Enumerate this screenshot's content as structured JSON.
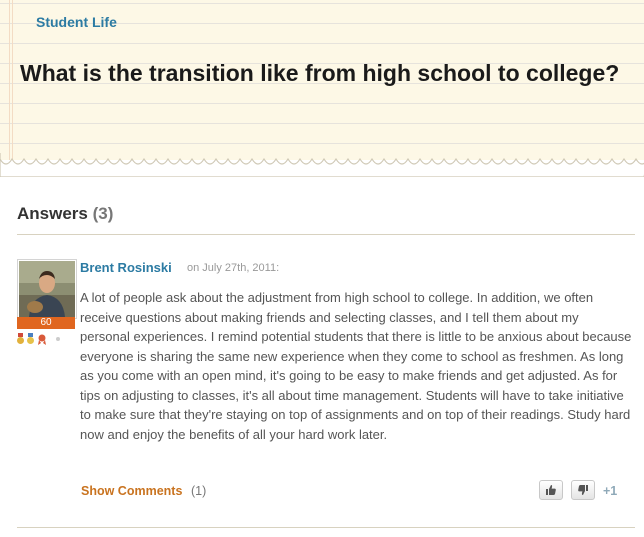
{
  "question": {
    "category": "Student Life",
    "title": "What is the transition like from high school to college?"
  },
  "answers": {
    "heading": "Answers",
    "count": "(3)",
    "items": [
      {
        "author": "Brent Rosinski",
        "date": "on July 27th, 2011:",
        "karma": "60",
        "awards": [
          "medal-icon",
          "star-medal-icon",
          "ribbon-icon",
          "dot-icon"
        ],
        "body": "A lot of people ask about the adjustment from high school to college. In addition, we often receive questions about making friends and selecting classes, and I tell them about my personal experiences. I remind potential students that there is little to be anxious about because everyone is sharing the same new experience when they come to school as freshmen. As long as you come with an open mind, it's going to be easy to make friends and get adjusted. As for tips on adjusting to classes, it's all about time management. Students will have to take initiative to make sure that they're staying on top of assignments and on top of their readings. Study hard now and enjoy the benefits of all your hard work later.",
        "show_comments": "Show Comments",
        "comment_count": "(1)",
        "vote_score": "+1"
      }
    ]
  },
  "colors": {
    "link_blue": "#2c7ba3",
    "accent_orange": "#c9731f",
    "karma_orange": "#e0661f",
    "notepad_bg": "#fdf8e6"
  }
}
